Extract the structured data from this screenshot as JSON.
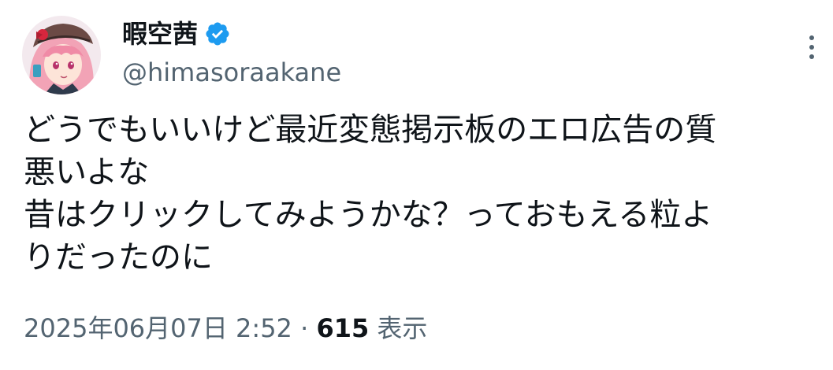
{
  "author": {
    "display_name": "暇空茜",
    "handle": "@himasoraakane",
    "verified": true,
    "verified_color": "#1d9bf0"
  },
  "tweet": {
    "lines": [
      "どうでもいいけど最近変態掲示板のエロ広告の質",
      "悪いよな",
      "昔はクリックしてみようかな？っておもえる粒よ",
      "りだったのに"
    ]
  },
  "meta": {
    "timestamp": "2025年06月07日 2:52",
    "separator": "·",
    "views_count": "615",
    "views_label": "表示"
  },
  "icons": {
    "more": "more-vertical-icon",
    "verified": "verified-badge-icon"
  },
  "colors": {
    "primary_text": "#0f1419",
    "secondary_text": "#536471",
    "accent": "#1d9bf0"
  }
}
